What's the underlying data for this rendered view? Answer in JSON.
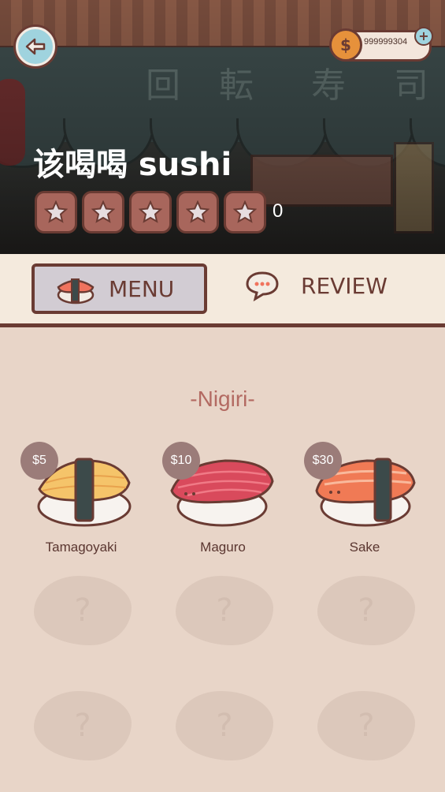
{
  "header": {
    "shop_name": "该喝喝 sushi",
    "kanji": [
      "回",
      "転",
      "寿",
      "司"
    ],
    "rating_count": "0",
    "star_count": 5
  },
  "currency": {
    "coins": "999999304",
    "coin_symbol": "$",
    "add_symbol": "+"
  },
  "tabs": {
    "menu": "MENU",
    "review": "REVIEW"
  },
  "menu": {
    "section_title": "-Nigiri-",
    "items": [
      {
        "name": "Tamagoyaki",
        "price": "$5"
      },
      {
        "name": "Maguro",
        "price": "$10"
      },
      {
        "name": "Sake",
        "price": "$30"
      }
    ],
    "locked_mark": "?"
  },
  "colors": {
    "accent": "#6a3b33",
    "background": "#e8d5c8",
    "price_badge": "#9b7c79",
    "section_title": "#b36a62"
  }
}
